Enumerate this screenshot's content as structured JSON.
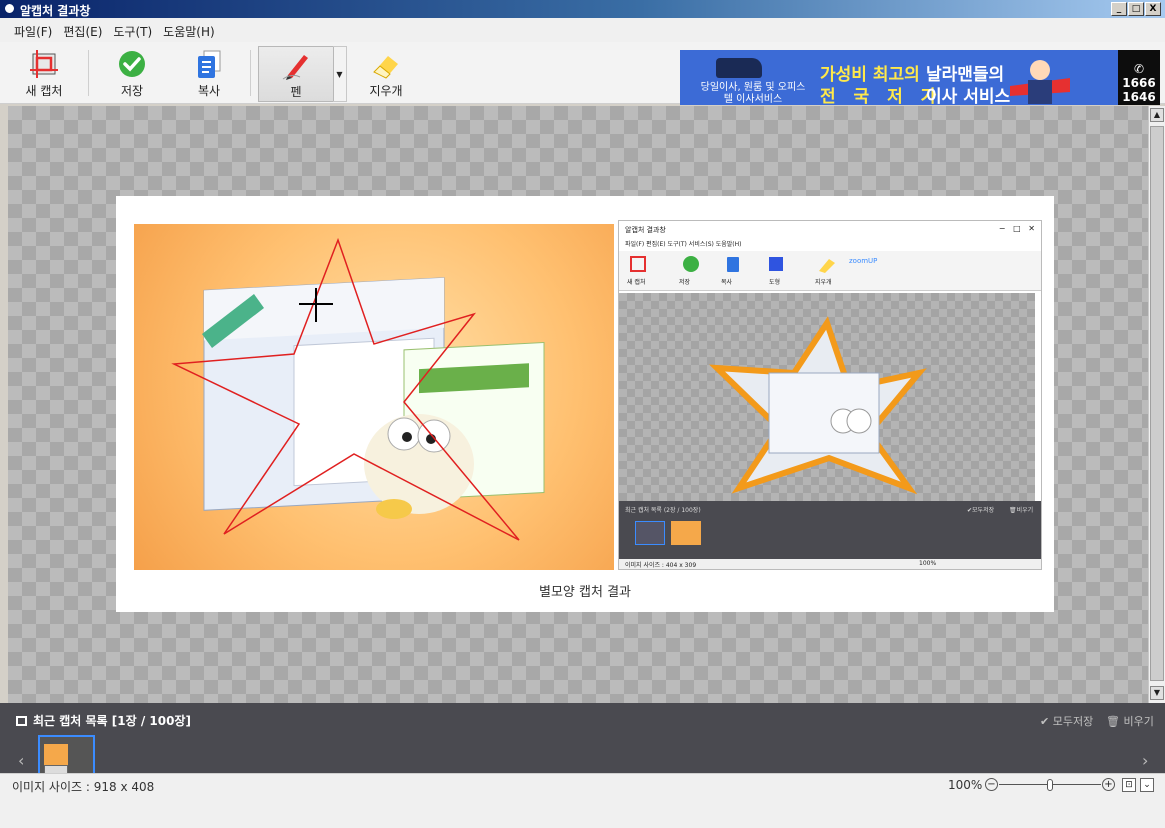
{
  "window": {
    "title": "알캡처 결과창",
    "buttons": [
      "_",
      "□",
      "X"
    ]
  },
  "menu": [
    "파일(F)",
    "편집(E)",
    "도구(T)",
    "도움말(H)"
  ],
  "toolbar": {
    "new_capture": "새 캡처",
    "save": "저장",
    "copy": "복사",
    "pen": "펜",
    "eraser": "지우개"
  },
  "ad": {
    "sub": "당일이사, 원룸 및 오피스텔 이사서비스",
    "line1a": "가성비 최고의",
    "line1b": "전 국 저 가",
    "line2a": "날라맨들의",
    "line2b": "이사 서비스",
    "phone1": "1666",
    "phone2": "1646"
  },
  "canvas": {
    "caption": "별모양 캡처 결과",
    "right_window": {
      "title": "알캡처 결과창",
      "menu": "파일(F)  편집(E)  도구(T)  서비스(S)  도움말(H)",
      "tools": [
        "새 캡처",
        "저장",
        "복사",
        "도형",
        "지우개"
      ],
      "ad": "zoomUP",
      "list_title": "최근 캡처 목록 (2장 / 100장)",
      "save_all": "✔모두저장",
      "clear": "🗑비우기",
      "size": "이미지 사이즈 : 404 x 309",
      "zoom": "100%"
    }
  },
  "recent": {
    "title": "최근 캡처 목록 [1장 / 100장]",
    "save_all": "✔ 모두저장",
    "clear": "🗑 비우기"
  },
  "status": {
    "image_size": "이미지 사이즈 : 918 x 408",
    "zoom": "100%"
  },
  "colors": {
    "accent": "#3b8cff",
    "panel": "#4a4a50",
    "star_stroke": "#e02020"
  }
}
